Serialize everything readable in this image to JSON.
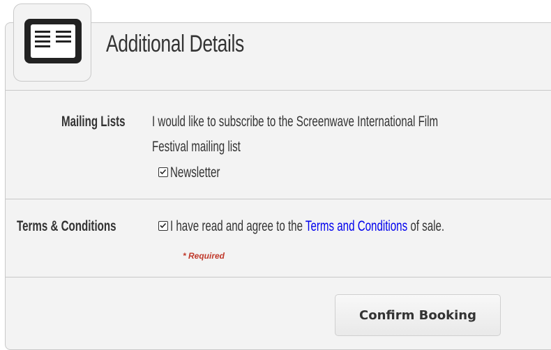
{
  "header": {
    "title": "Additional Details",
    "icon": "newspaper-icon"
  },
  "mailing": {
    "label": "Mailing Lists",
    "description_line1": "I would like to subscribe to the Screenwave International Film",
    "description_line2": "Festival mailing list",
    "newsletter_label": "Newsletter",
    "newsletter_checked": true
  },
  "terms": {
    "label": "Terms & Conditions",
    "checked": true,
    "text_before": "I have read and agree to the ",
    "link_text": "Terms and Conditions",
    "text_after": " of sale.",
    "required_note": "* Required"
  },
  "actions": {
    "confirm_label": "Confirm Booking"
  },
  "colors": {
    "panel_bg": "#f3f3f3",
    "link": "#0000ee",
    "required": "#c0392b"
  }
}
